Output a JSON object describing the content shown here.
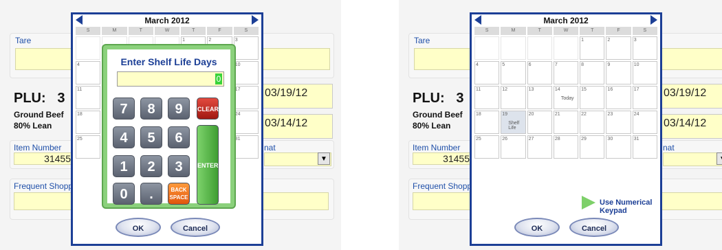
{
  "form": {
    "tare_label": "Tare",
    "plu_label": "PLU:",
    "plu_value": "3",
    "desc_line1": "Ground Beef",
    "desc_line2": "80% Lean",
    "date1": "03/19/12",
    "date2": "03/14/12",
    "item_number_label": "Item Number",
    "item_number_value": "31455",
    "frequent_shopper_label": "Frequent Shoppe",
    "right_dropdown_label": "nat"
  },
  "calendar": {
    "month": "March 2012",
    "days_of_week": [
      "S",
      "M",
      "T",
      "W",
      "T",
      "F",
      "S"
    ],
    "cells": [
      {
        "day": "",
        "tag": ""
      },
      {
        "day": "",
        "tag": ""
      },
      {
        "day": "",
        "tag": ""
      },
      {
        "day": "",
        "tag": ""
      },
      {
        "day": "1",
        "tag": ""
      },
      {
        "day": "2",
        "tag": ""
      },
      {
        "day": "3",
        "tag": ""
      },
      {
        "day": "4",
        "tag": ""
      },
      {
        "day": "5",
        "tag": ""
      },
      {
        "day": "6",
        "tag": ""
      },
      {
        "day": "7",
        "tag": ""
      },
      {
        "day": "8",
        "tag": ""
      },
      {
        "day": "9",
        "tag": ""
      },
      {
        "day": "10",
        "tag": ""
      },
      {
        "day": "11",
        "tag": ""
      },
      {
        "day": "12",
        "tag": ""
      },
      {
        "day": "13",
        "tag": ""
      },
      {
        "day": "14",
        "tag": "Today"
      },
      {
        "day": "15",
        "tag": ""
      },
      {
        "day": "16",
        "tag": ""
      },
      {
        "day": "17",
        "tag": ""
      },
      {
        "day": "18",
        "tag": ""
      },
      {
        "day": "19",
        "tag": "Shelf Life"
      },
      {
        "day": "20",
        "tag": ""
      },
      {
        "day": "21",
        "tag": ""
      },
      {
        "day": "22",
        "tag": ""
      },
      {
        "day": "23",
        "tag": ""
      },
      {
        "day": "24",
        "tag": ""
      },
      {
        "day": "25",
        "tag": ""
      },
      {
        "day": "26",
        "tag": ""
      },
      {
        "day": "27",
        "tag": ""
      },
      {
        "day": "28",
        "tag": ""
      },
      {
        "day": "29",
        "tag": ""
      },
      {
        "day": "30",
        "tag": ""
      },
      {
        "day": "31",
        "tag": ""
      }
    ],
    "ok_label": "OK",
    "cancel_label": "Cancel",
    "numerical_keypad_label": "Use Numerical Keypad"
  },
  "keypad": {
    "title": "Enter Shelf Life Days",
    "display_value": "0",
    "keys": [
      "7",
      "8",
      "9",
      "4",
      "5",
      "6",
      "1",
      "2",
      "3",
      "0",
      "."
    ],
    "clear_label": "CLEAR",
    "enter_label": "ENTER",
    "back_label_1": "BACK",
    "back_label_2": "SPACE"
  },
  "colors": {
    "dialog_border": "#1c3f96",
    "field_yellow": "#ffffc8",
    "keypad_green": "#8bd17c"
  }
}
